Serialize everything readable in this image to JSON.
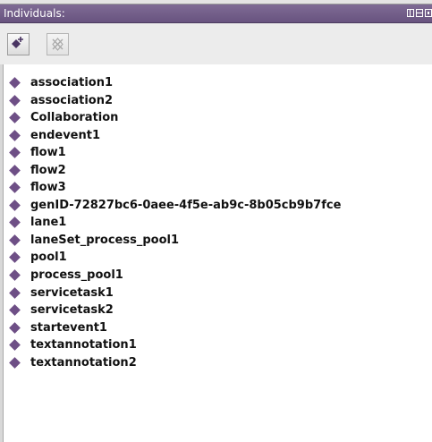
{
  "panel": {
    "title": "Individuals:",
    "view_icons": [
      "panel-icon-columns",
      "panel-icon-rows",
      "panel-icon-single"
    ]
  },
  "toolbar": {
    "buttons": [
      {
        "name": "add-individual",
        "icon": "diamond-add-icon",
        "enabled": true
      },
      {
        "name": "delete-individual",
        "icon": "diamond-delete-icon",
        "enabled": false
      }
    ]
  },
  "individuals": [
    "association1",
    "association2",
    "Collaboration",
    "endevent1",
    "flow1",
    "flow2",
    "flow3",
    "genID-72827bc6-0aee-4f5e-ab9c-8b05cb9b7fce",
    "lane1",
    "laneSet_process_pool1",
    "pool1",
    "process_pool1",
    "servicetask1",
    "servicetask2",
    "startevent1",
    "textannotation1",
    "textannotation2"
  ],
  "colors": {
    "titlebar": "#6d5985",
    "individual_icon": "#6e4f86",
    "toolbar": "#ececec"
  }
}
